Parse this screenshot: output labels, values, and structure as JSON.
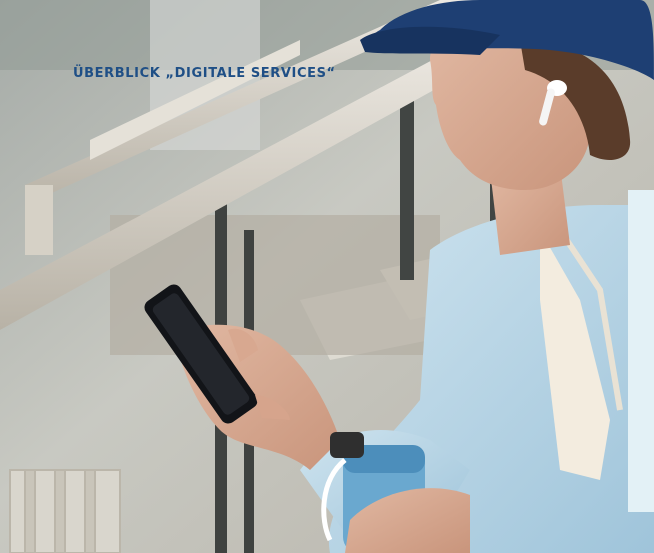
{
  "header": {
    "kicker": "ÜBERBLICK „DIGITALE SERVICES“"
  },
  "colors": {
    "kicker_text": "#1f4f86",
    "info_panel": "#e3f1f6"
  },
  "photo": {
    "icons": [
      "smartphone-icon",
      "earbud-icon",
      "water-bottle-icon"
    ]
  }
}
